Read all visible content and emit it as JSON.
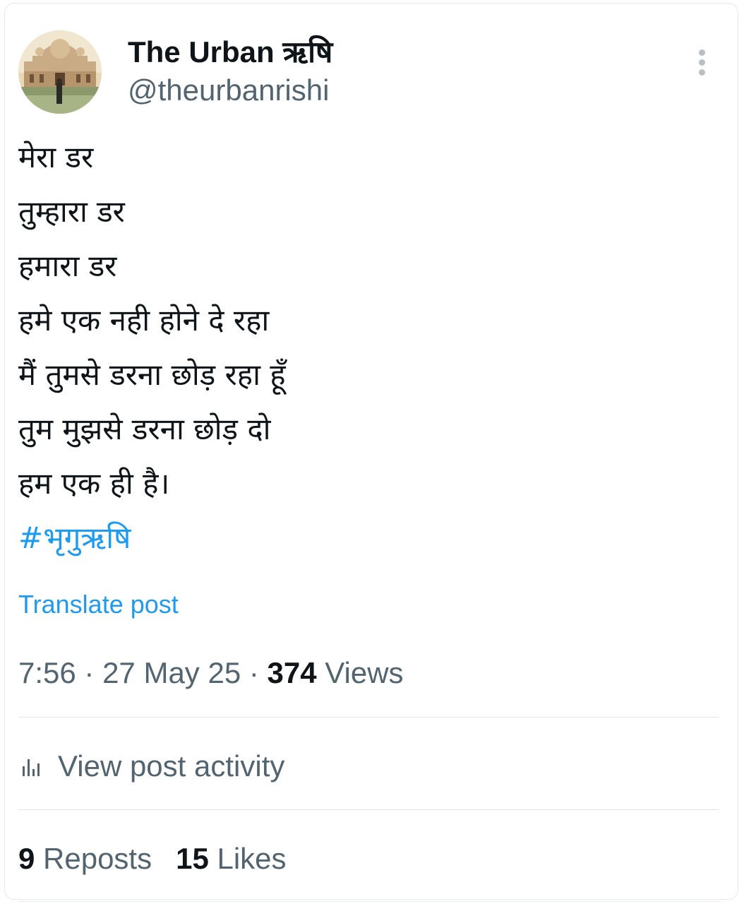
{
  "author": {
    "display_name": "The Urban ऋषि",
    "handle": "@theurbanrishi"
  },
  "tweet": {
    "lines": [
      "मेरा डर",
      "तुम्हारा डर",
      "हमारा डर",
      "हमे एक नही होने दे रहा",
      "मैं तुमसे डरना छोड़ रहा हूँ",
      "तुम मुझसे डरना छोड़ दो",
      "हम एक ही है।"
    ],
    "hashtag": "#भृगुऋषि",
    "translate_label": "Translate post"
  },
  "meta": {
    "time": "7:56",
    "separator": " · ",
    "date": "27 May 25",
    "views_count": "374",
    "views_label": " Views"
  },
  "activity": {
    "label": "View post activity"
  },
  "stats": {
    "reposts_count": "9",
    "reposts_label": " Reposts",
    "likes_count": "15",
    "likes_label": " Likes"
  },
  "colors": {
    "link": "#1d9bf0",
    "text": "#0f1419",
    "secondary": "#536471"
  }
}
